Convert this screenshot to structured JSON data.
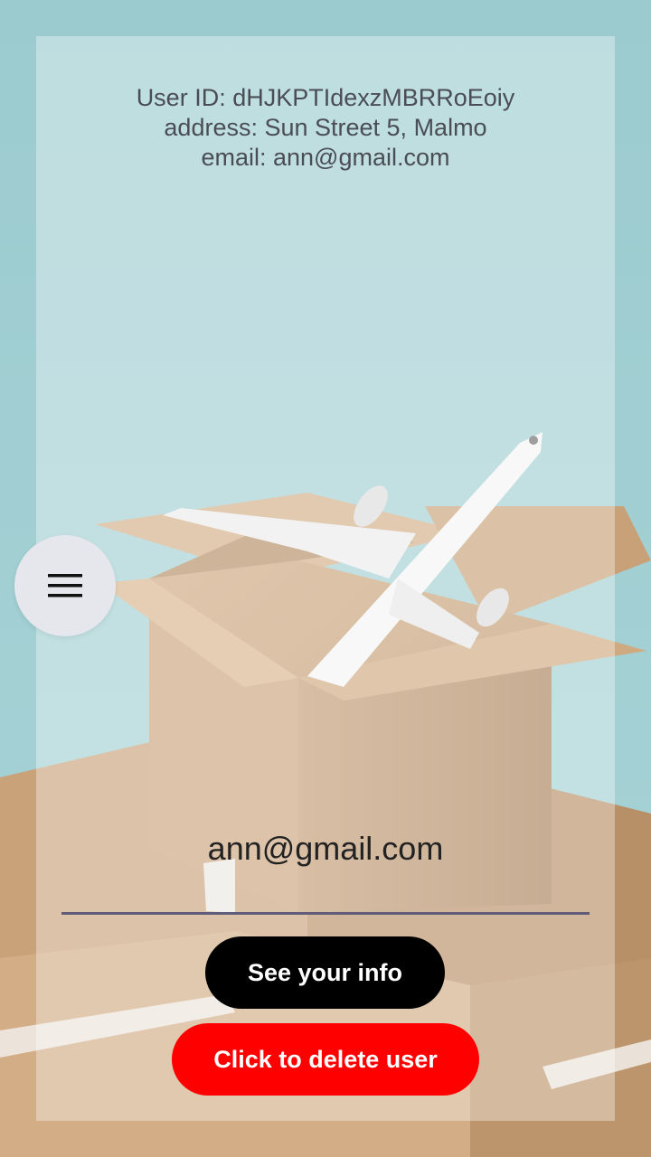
{
  "user": {
    "id_line": "User ID: dHJKPTIdexzMBRRoEoiy",
    "address_line": "address: Sun Street 5, Malmo",
    "email_line": "email: ann@gmail.com"
  },
  "form": {
    "email_value": "ann@gmail.com"
  },
  "buttons": {
    "see_info": "See your info",
    "delete_user": "Click to delete user"
  },
  "menu": {
    "icon": "hamburger-menu-icon"
  },
  "colors": {
    "background": "#9fcdd0",
    "info_button": "#000000",
    "delete_button": "#ff0000",
    "underline": "#5f5d79"
  }
}
